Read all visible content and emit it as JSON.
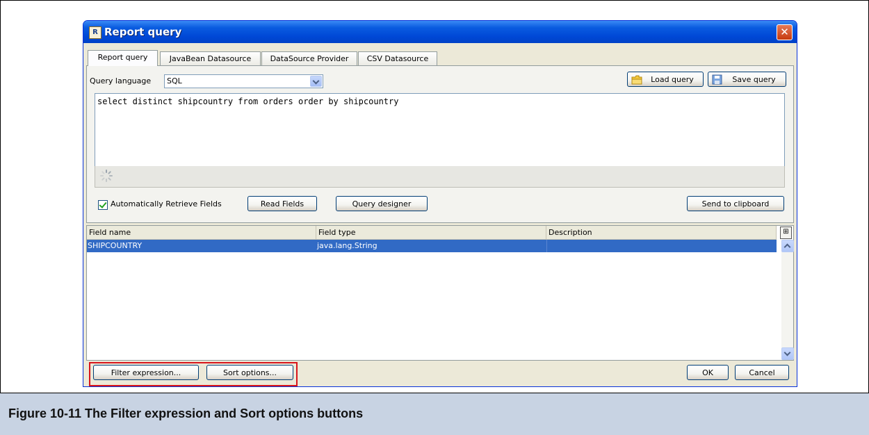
{
  "window": {
    "title": "Report query",
    "close_glyph": "✕",
    "app_icon": "report-app-icon",
    "app_icon_glyph": "R"
  },
  "tabs": [
    {
      "label": "Report query",
      "active": true
    },
    {
      "label": "JavaBean Datasource",
      "active": false
    },
    {
      "label": "DataSource Provider",
      "active": false
    },
    {
      "label": "CSV Datasource",
      "active": false
    }
  ],
  "query": {
    "language_label": "Query language",
    "language_value": "SQL",
    "load_label": "Load query",
    "save_label": "Save query",
    "text": "select distinct shipcountry from orders order by shipcountry"
  },
  "options": {
    "auto_retrieve_label": "Automatically Retrieve Fields",
    "auto_retrieve_checked": true,
    "read_fields_label": "Read Fields",
    "query_designer_label": "Query designer",
    "clipboard_label": "Send to clipboard"
  },
  "fields_table": {
    "columns": [
      "Field name",
      "Field type",
      "Description"
    ],
    "rows": [
      {
        "name": "SHIPCOUNTRY",
        "type": "java.lang.String",
        "description": "",
        "selected": true
      }
    ]
  },
  "footer": {
    "filter_label": "Filter expression...",
    "sort_label": "Sort options...",
    "ok_label": "OK",
    "cancel_label": "Cancel"
  },
  "caption": "Figure 10-11 The Filter expression and Sort options buttons",
  "colors": {
    "highlight_box": "#d8141b",
    "selection": "#316ac5",
    "titlebar": "#0048d6"
  }
}
